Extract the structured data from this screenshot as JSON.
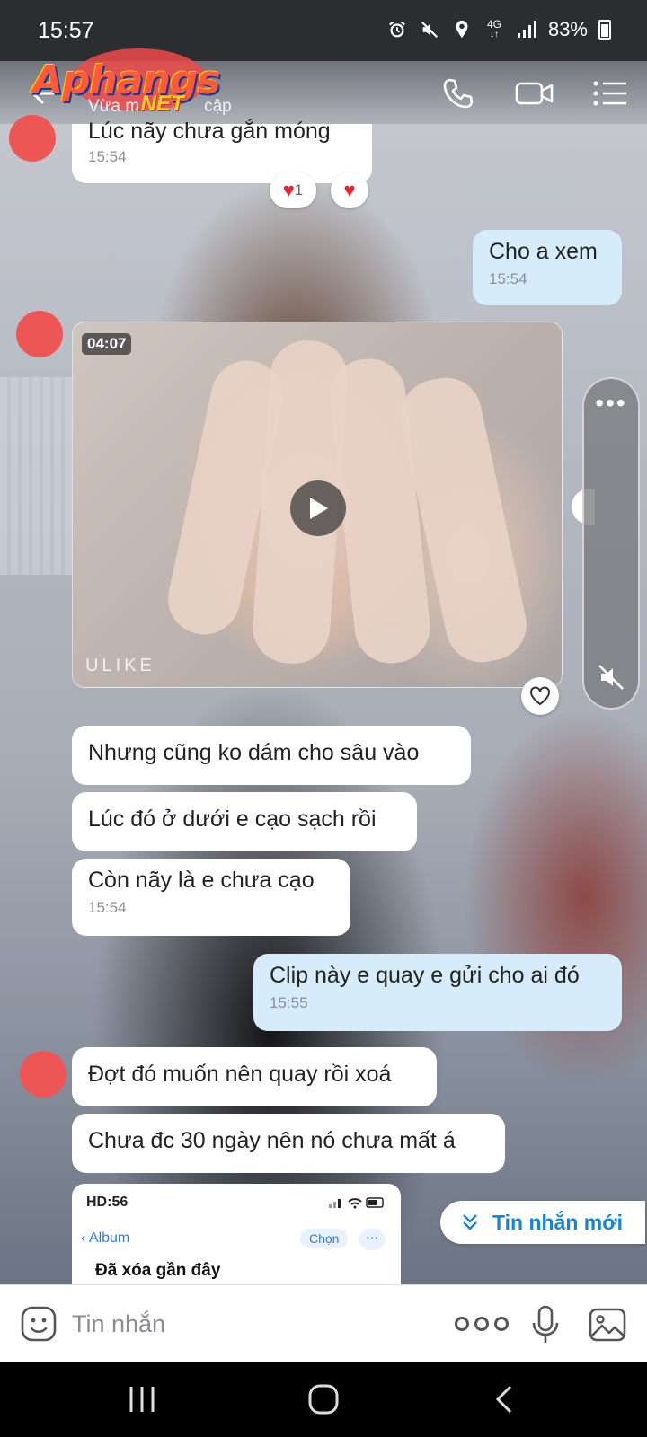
{
  "status_bar": {
    "time": "15:57",
    "network": "4G",
    "battery": "83%"
  },
  "header": {
    "logo": "Aphangs",
    "logo_suffix": ".NET",
    "subtitle": "Vừa m",
    "subtitle_tail": "cập"
  },
  "messages": {
    "m1": {
      "text": "Lúc nãy chưa gắn móng",
      "time": "15:54",
      "reaction_count": "1"
    },
    "m2": {
      "text": "Cho a xem",
      "time": "15:54"
    },
    "video": {
      "duration": "04:07",
      "watermark": "ULIKE"
    },
    "m3": {
      "text": "Nhưng cũng ko dám cho sâu vào"
    },
    "m4": {
      "text": "Lúc đó ở dưới e cạo sạch rồi"
    },
    "m5": {
      "text": "Còn nãy là e chưa cạo",
      "time": "15:54"
    },
    "m6": {
      "text": "Clip này e quay e gửi cho ai đó",
      "time": "15:55"
    },
    "m7": {
      "text": "Đợt đó muốn nên quay rồi xoá"
    },
    "m8": {
      "text": "Chưa đc 30 ngày nên nó chưa mất á"
    }
  },
  "album_preview": {
    "status": "HD:56",
    "back_label": "Album",
    "choose_label": "Chọn",
    "more_label": "···",
    "title": "Đã xóa gần đây"
  },
  "new_messages": {
    "label": "Tin nhắn mới"
  },
  "input": {
    "placeholder": "Tin nhắn"
  },
  "colors": {
    "my_bubble": "#d7ecfb",
    "accent": "#1583d8",
    "avatar": "#ee5656"
  }
}
